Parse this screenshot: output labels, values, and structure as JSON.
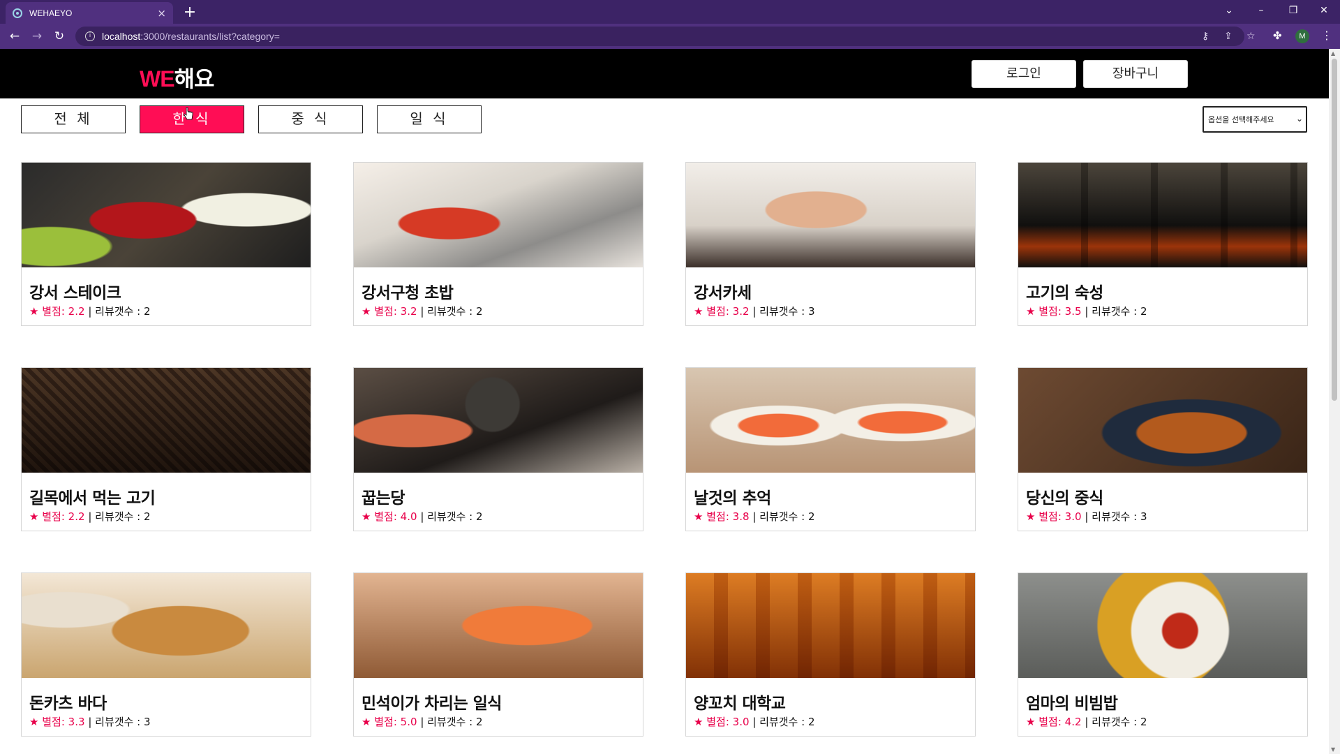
{
  "browser": {
    "tab_title": "WEHAEYO",
    "tab_close": "×",
    "new_tab": "+",
    "url_host": "localhost",
    "url_path": ":3000/restaurants/list?category=",
    "profile_initial": "M",
    "window_controls": {
      "tabsearch": "⌄",
      "minimize": "–",
      "restore": "❐",
      "close": "✕"
    }
  },
  "header": {
    "logo_we": "WE",
    "logo_haeyo": "해요",
    "login_label": "로그인",
    "cart_label": "장바구니"
  },
  "categories": [
    {
      "label": "전 체",
      "active": false
    },
    {
      "label": "한 식",
      "active": true
    },
    {
      "label": "중 식",
      "active": false
    },
    {
      "label": "일 식",
      "active": false
    }
  ],
  "sort": {
    "selected": "옵션을 선택해주세요"
  },
  "labels": {
    "rating": "별점:",
    "reviews": "리뷰갯수 :",
    "separator": "|"
  },
  "restaurants": [
    {
      "name": "강서 스테이크",
      "rating": "2.2",
      "reviews": "2",
      "photo": "steak"
    },
    {
      "name": "강서구청 초밥",
      "rating": "3.2",
      "reviews": "2",
      "photo": "sushi"
    },
    {
      "name": "강서카세",
      "rating": "3.2",
      "reviews": "3",
      "photo": "omakase"
    },
    {
      "name": "고기의 숙성",
      "rating": "3.5",
      "reviews": "2",
      "photo": "grill"
    },
    {
      "name": "길목에서 먹는 고기",
      "rating": "2.2",
      "reviews": "2",
      "photo": "street"
    },
    {
      "name": "꿉는당",
      "rating": "4.0",
      "reviews": "2",
      "photo": "stew"
    },
    {
      "name": "날것의 추억",
      "rating": "3.8",
      "reviews": "2",
      "photo": "salmon"
    },
    {
      "name": "당신의 중식",
      "rating": "3.0",
      "reviews": "3",
      "photo": "chinese"
    },
    {
      "name": "돈카츠 바다",
      "rating": "3.3",
      "reviews": "3",
      "photo": "tonkatsu"
    },
    {
      "name": "민석이가 차리는 일식",
      "rating": "5.0",
      "reviews": "2",
      "photo": "nigiri"
    },
    {
      "name": "양꼬치 대학교",
      "rating": "3.0",
      "reviews": "2",
      "photo": "skewer"
    },
    {
      "name": "엄마의 비빔밥",
      "rating": "4.2",
      "reviews": "2",
      "photo": "bibimbap"
    }
  ],
  "colors": {
    "accent": "#ff0d55",
    "header_bg": "#000000",
    "browser_frame": "#50307f"
  }
}
